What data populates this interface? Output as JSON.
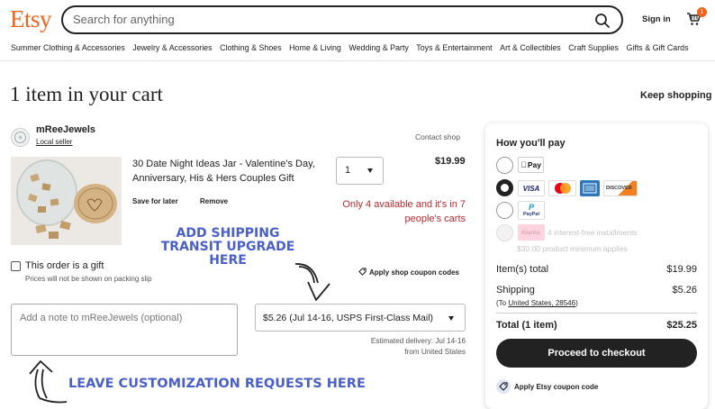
{
  "header": {
    "logo": "Etsy",
    "search_placeholder": "Search for anything",
    "signin_label": "Sign in",
    "cart_count": "1",
    "categories": [
      "Summer Clothing & Accessories",
      "Jewelry & Accessories",
      "Clothing & Shoes",
      "Home & Living",
      "Wedding & Party",
      "Toys & Entertainment",
      "Art & Collectibles",
      "Craft Supplies",
      "Gifts & Gift Cards"
    ]
  },
  "page": {
    "title": "1 item in your cart",
    "keep_shopping": "Keep shopping"
  },
  "shop": {
    "name": "mReeJewels",
    "badge": "Local seller",
    "contact": "Contact shop"
  },
  "item": {
    "title": "30 Date Night Ideas Jar - Valentine's Day, Anniversary, His & Hers Couples Gift",
    "save_for_later": "Save for later",
    "remove": "Remove",
    "quantity": "1",
    "price": "$19.99",
    "stock_notice": "Only 4 available and it's in 7 people's carts"
  },
  "annotations": {
    "shipping_promo": "ADD SHIPPING TRANSIT UPGRADE HERE",
    "customization_promo": "LEAVE CUSTOMIZATION REQUESTS HERE"
  },
  "gift": {
    "label": "This order is a gift",
    "sub": "Prices will not be shown on packing slip"
  },
  "coupon_codes_link": "Apply shop coupon codes",
  "note_placeholder": "Add a note to mReeJewels (optional)",
  "shipping": {
    "selected": "$5.26 (Jul 14-16, USPS First-Class Mail)",
    "estimated_line1": "Estimated delivery: Jul 14-16",
    "estimated_line2": "from United States"
  },
  "summary": {
    "title": "How you'll pay",
    "payment_labels": {
      "apple": "Pay",
      "visa": "VISA",
      "discover": "DISCOVER",
      "paypal": "PayPal",
      "klarna": "Klarna."
    },
    "klarna_text": "4 interest-free installments",
    "klarna_min": "$30.00 product minimum applies",
    "item_total_label": "Item(s) total",
    "item_total": "$19.99",
    "shipping_label": "Shipping",
    "shipping_value": "$5.26",
    "ship_to_prefix": "(To",
    "ship_to_link": "United States, 28546",
    "ship_to_suffix": ")",
    "total_label": "Total (1 item)",
    "total": "$25.25",
    "checkout_button": "Proceed to checkout",
    "etsy_coupon": "Apply Etsy coupon code"
  },
  "colors": {
    "brand": "#f1641e",
    "promo_blue": "#4a5fc8",
    "stock_red": "#b8292f",
    "button_dark": "#222222"
  }
}
